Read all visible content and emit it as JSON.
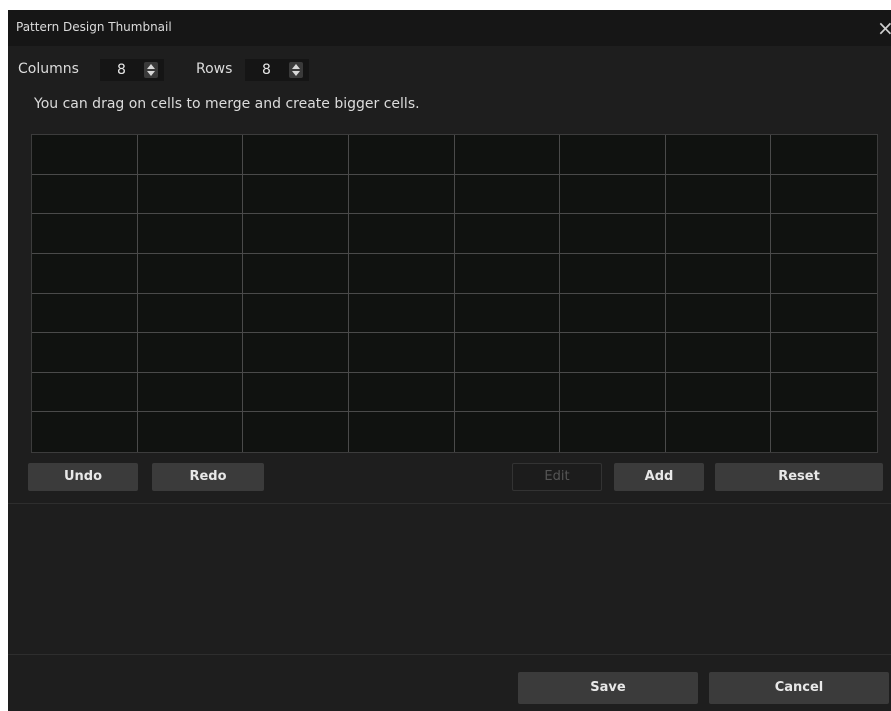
{
  "window": {
    "title": "Pattern Design Thumbnail",
    "close_icon": "×"
  },
  "controls": {
    "columns_label": "Columns",
    "columns_value": "8",
    "rows_label": "Rows",
    "rows_value": "8"
  },
  "hint": "You can drag on cells to merge and create bigger cells.",
  "grid": {
    "columns": 8,
    "rows": 8
  },
  "buttons": {
    "undo": "Undo",
    "redo": "Redo",
    "edit": "Edit",
    "add": "Add",
    "reset": "Reset",
    "save": "Save",
    "cancel": "Cancel"
  },
  "colors": {
    "background": "#1e1e1e",
    "grid_bg": "#101210",
    "button": "#3b3b3b"
  }
}
